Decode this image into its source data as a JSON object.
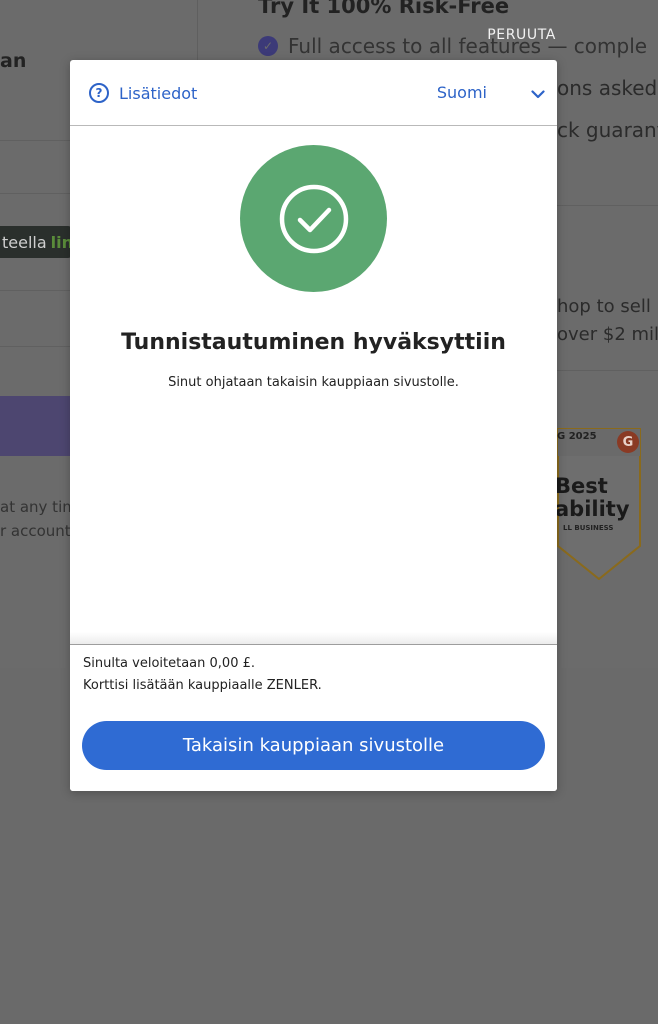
{
  "background": {
    "title": "Try It 100% Risk-Free",
    "features": [
      "Full access to all features — comple",
      "ons asked",
      "ck guarant"
    ],
    "left_heading": "an",
    "link_pill": {
      "prefix": "teella",
      "link": "lin"
    },
    "left_notes": [
      "at any tim",
      "r account"
    ],
    "right_notes": [
      "hop to sell",
      "over $2 mil"
    ],
    "badge": {
      "season": "G 2025",
      "logo": "G",
      "line1": "Best",
      "line2": "ability",
      "line3": "LL BUSINESS"
    }
  },
  "cancel_label": "PERUUTA",
  "modal": {
    "header": {
      "help_label": "Lisätiedot",
      "help_icon": "question-circle-icon",
      "language": "Suomi",
      "language_icon": "chevron-down-icon"
    },
    "body": {
      "status_icon": "check-circle-icon",
      "title": "Tunnistautuminen hyväksyttiin",
      "message": "Sinut ohjataan takaisin kauppiaan sivustolle."
    },
    "footer": {
      "charge_text": "Sinulta veloitetaan 0,00 £.",
      "card_text": "Korttisi lisätään kauppiaalle ZENLER.",
      "return_button": "Takaisin kauppiaan sivustolle"
    }
  },
  "colors": {
    "accent": "#2f6bd3",
    "link": "#2d63c8",
    "success": "#5ba771",
    "overlay": "#6b6b6b"
  }
}
